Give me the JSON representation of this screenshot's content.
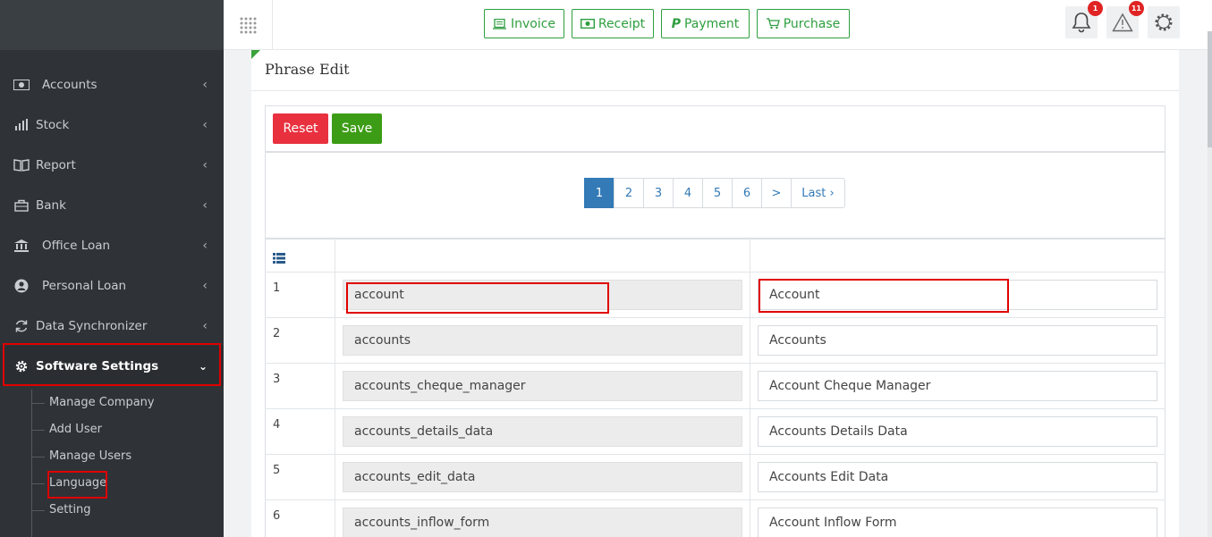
{
  "sidebar": {
    "items": [
      {
        "label": "Accounts",
        "icon": "money-icon"
      },
      {
        "label": "Stock",
        "icon": "bar-chart-icon"
      },
      {
        "label": "Report",
        "icon": "book-icon"
      },
      {
        "label": "Bank",
        "icon": "briefcase-icon"
      },
      {
        "label": "Office Loan",
        "icon": "bank-icon"
      },
      {
        "label": "Personal Loan",
        "icon": "user-circle-icon"
      },
      {
        "label": "Data Synchronizer",
        "icon": "sync-icon"
      },
      {
        "label": "Software Settings",
        "icon": "gear-icon"
      }
    ],
    "sub_items": [
      "Manage Company",
      "Add User",
      "Manage Users",
      "Language",
      "Setting"
    ]
  },
  "topbar": {
    "buttons": [
      {
        "label": "Invoice",
        "icon": "invoice-icon"
      },
      {
        "label": "Receipt",
        "icon": "money-icon"
      },
      {
        "label": "Payment",
        "icon": "paypal-icon"
      },
      {
        "label": "Purchase",
        "icon": "cart-icon"
      }
    ],
    "notifications_count": "1",
    "alerts_count": "11"
  },
  "panel": {
    "title": "Phrase Edit",
    "reset_label": "Reset",
    "save_label": "Save",
    "reset_color": "#e8303e",
    "save_color": "#3d9c15"
  },
  "pagination": {
    "pages": [
      "1",
      "2",
      "3",
      "4",
      "5",
      "6",
      ">",
      "Last ›"
    ],
    "active": "1"
  },
  "table": {
    "rows": [
      {
        "num": "1",
        "phrase": "account",
        "value": "Account"
      },
      {
        "num": "2",
        "phrase": "accounts",
        "value": "Accounts"
      },
      {
        "num": "3",
        "phrase": "accounts_cheque_manager",
        "value": "Account Cheque Manager"
      },
      {
        "num": "4",
        "phrase": "accounts_details_data",
        "value": "Accounts Details Data"
      },
      {
        "num": "5",
        "phrase": "accounts_edit_data",
        "value": "Accounts Edit Data"
      },
      {
        "num": "6",
        "phrase": "accounts_inflow_form",
        "value": "Account Inflow Form"
      }
    ]
  }
}
